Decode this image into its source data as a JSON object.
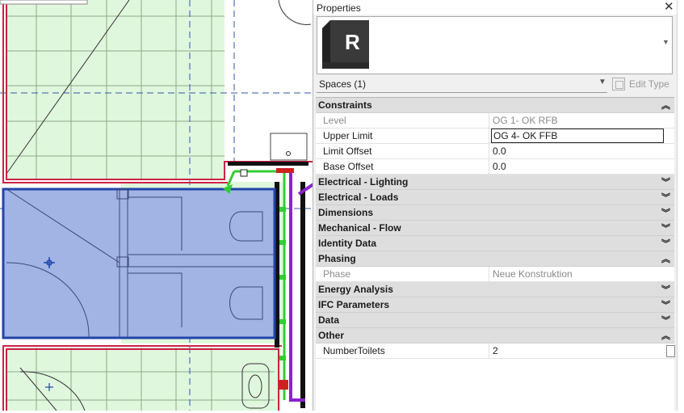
{
  "palette": {
    "title": "Properties",
    "close_symbol": "✕",
    "type_logo_letter": "R",
    "selector_value": "Spaces (1)",
    "edit_type_label": "Edit Type"
  },
  "properties": [
    {
      "kind": "group",
      "name": "Constraints",
      "state": "expanded"
    },
    {
      "kind": "prop",
      "name": "Level",
      "value": "OG 1- OK RFB",
      "readonly": true
    },
    {
      "kind": "prop",
      "name": "Upper Limit",
      "value": "OG 4- OK FFB",
      "editing": true
    },
    {
      "kind": "prop",
      "name": "Limit Offset",
      "value": "0.0"
    },
    {
      "kind": "prop",
      "name": "Base Offset",
      "value": "0.0"
    },
    {
      "kind": "group",
      "name": "Electrical - Lighting",
      "state": "collapsed"
    },
    {
      "kind": "group",
      "name": "Electrical - Loads",
      "state": "collapsed"
    },
    {
      "kind": "group",
      "name": "Dimensions",
      "state": "collapsed"
    },
    {
      "kind": "group",
      "name": "Mechanical - Flow",
      "state": "collapsed"
    },
    {
      "kind": "group",
      "name": "Identity Data",
      "state": "collapsed"
    },
    {
      "kind": "group",
      "name": "Phasing",
      "state": "expanded"
    },
    {
      "kind": "prop",
      "name": "Phase",
      "value": "Neue Konstruktion",
      "readonly": true
    },
    {
      "kind": "group",
      "name": "Energy Analysis",
      "state": "collapsed"
    },
    {
      "kind": "group",
      "name": "IFC Parameters",
      "state": "collapsed"
    },
    {
      "kind": "group",
      "name": "Data",
      "state": "collapsed"
    },
    {
      "kind": "group",
      "name": "Other",
      "state": "expanded"
    },
    {
      "kind": "prop",
      "name": "NumberToilets",
      "value": "2",
      "checkbox": true
    }
  ],
  "icons": {
    "collapsed": "chevron-double-down-icon",
    "expanded": "chevron-double-up-icon"
  },
  "colors": {
    "room_fill": "#dff7dc",
    "selected_space": "#a2b4e4",
    "wall_outline": "#cc2244",
    "grid_lines": "#8ea88c",
    "pipe_green": "#33cc33",
    "pipe_purple": "#8a22cc"
  }
}
